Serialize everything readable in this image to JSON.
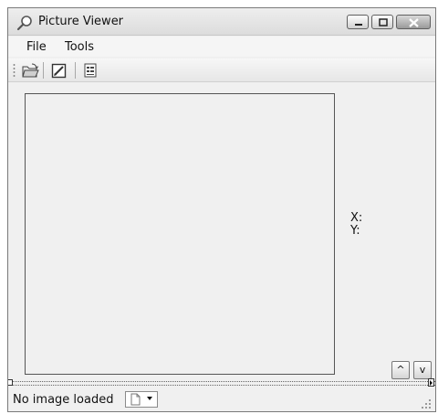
{
  "window": {
    "title": "Picture Viewer"
  },
  "menu": {
    "file": "File",
    "tools": "Tools"
  },
  "toolbar": {
    "icons": [
      "open-folder-icon",
      "edit-image-icon",
      "properties-icon"
    ]
  },
  "coordinates": {
    "x_label": "X:",
    "y_label": "Y:"
  },
  "navigation": {
    "up_label": "^",
    "down_label": "v"
  },
  "status": {
    "text": "No image loaded"
  }
}
